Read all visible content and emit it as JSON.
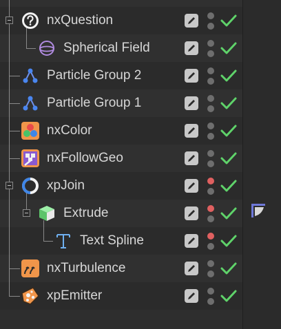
{
  "rows": [
    {
      "label": "nxQuestion",
      "icon": "question-icon",
      "ping": "gray"
    },
    {
      "label": "Spherical Field",
      "icon": "sphere-field-icon",
      "ping": "gray"
    },
    {
      "label": "Particle Group 2",
      "icon": "particle-group-icon",
      "ping": "gray"
    },
    {
      "label": "Particle Group 1",
      "icon": "particle-group-icon",
      "ping": "gray"
    },
    {
      "label": "nxColor",
      "icon": "color-icon",
      "ping": "gray"
    },
    {
      "label": "nxFollowGeo",
      "icon": "follow-geo-icon",
      "ping": "gray"
    },
    {
      "label": "xpJoin",
      "icon": "join-icon",
      "ping": "red"
    },
    {
      "label": "Extrude",
      "icon": "extrude-icon",
      "ping": "red"
    },
    {
      "label": "Text Spline",
      "icon": "text-spline-icon",
      "ping": "red"
    },
    {
      "label": "nxTurbulence",
      "icon": "turbulence-icon",
      "ping": "gray"
    },
    {
      "label": "xpEmitter",
      "icon": "emitter-icon",
      "ping": "gray"
    }
  ],
  "colors": {
    "check": "#5fd36a",
    "red_dot": "#e06060",
    "gray_dot": "#6e6e6e",
    "tag": "#6e78d8"
  },
  "tag_icon": "phong-tag-icon"
}
